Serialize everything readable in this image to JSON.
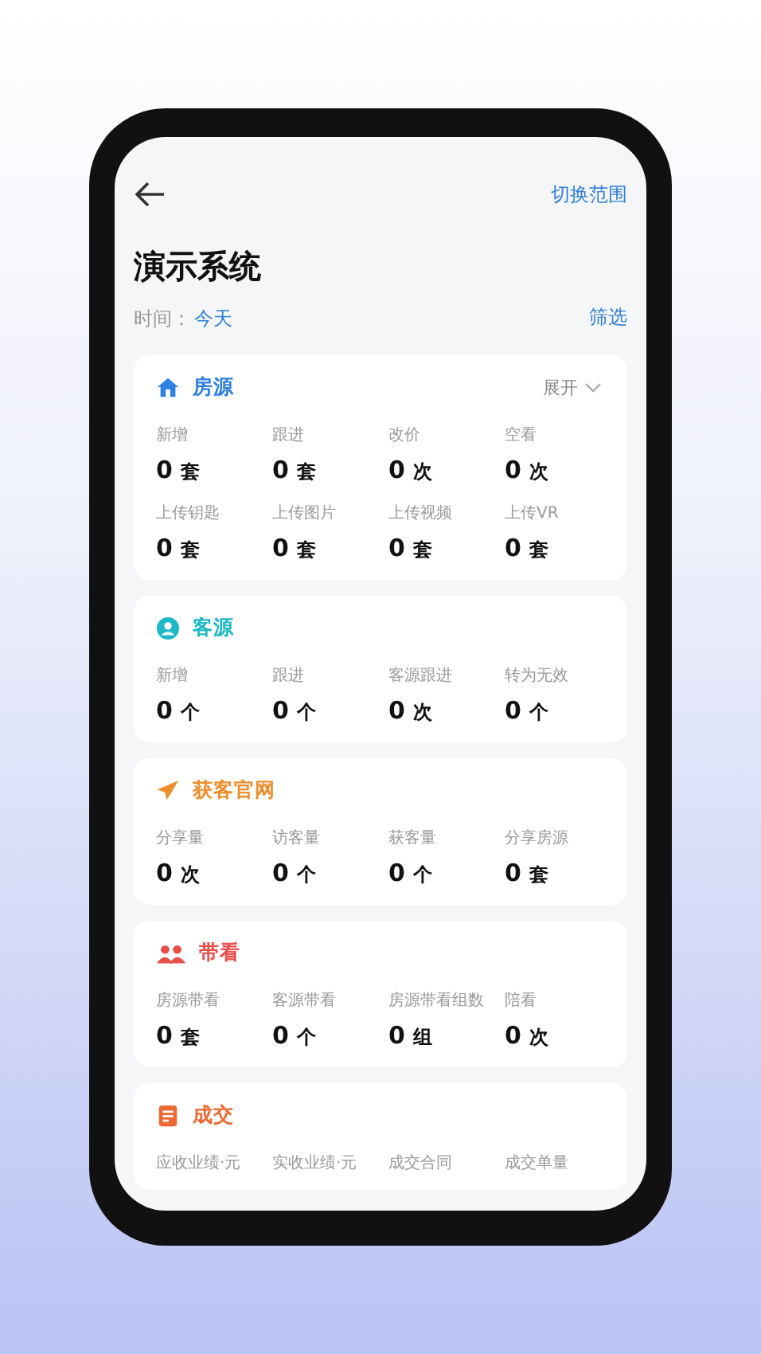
{
  "header": {
    "action": "切换范围",
    "title": "演示系统",
    "time_label": "时间：",
    "time_value": "今天",
    "filter": "筛选"
  },
  "sections": [
    {
      "kind": "house",
      "title": "房源",
      "color": "#2f80e0",
      "expand": "展开",
      "metrics": [
        {
          "label": "新增",
          "value": "0",
          "unit": "套"
        },
        {
          "label": "跟进",
          "value": "0",
          "unit": "套"
        },
        {
          "label": "改价",
          "value": "0",
          "unit": "次"
        },
        {
          "label": "空看",
          "value": "0",
          "unit": "次"
        },
        {
          "label": "上传钥匙",
          "value": "0",
          "unit": "套"
        },
        {
          "label": "上传图片",
          "value": "0",
          "unit": "套"
        },
        {
          "label": "上传视频",
          "value": "0",
          "unit": "套"
        },
        {
          "label": "上传VR",
          "value": "0",
          "unit": "套"
        }
      ]
    },
    {
      "kind": "person",
      "title": "客源",
      "color": "#1db8c6",
      "metrics": [
        {
          "label": "新增",
          "value": "0",
          "unit": "个"
        },
        {
          "label": "跟进",
          "value": "0",
          "unit": "个"
        },
        {
          "label": "客源跟进",
          "value": "0",
          "unit": "次"
        },
        {
          "label": "转为无效",
          "value": "0",
          "unit": "个"
        }
      ]
    },
    {
      "kind": "plane",
      "title": "获客官网",
      "color": "#ef8e2c",
      "metrics": [
        {
          "label": "分享量",
          "value": "0",
          "unit": "次"
        },
        {
          "label": "访客量",
          "value": "0",
          "unit": "个"
        },
        {
          "label": "获客量",
          "value": "0",
          "unit": "个"
        },
        {
          "label": "分享房源",
          "value": "0",
          "unit": "套"
        }
      ]
    },
    {
      "kind": "group",
      "title": "带看",
      "color": "#e84e4a",
      "metrics": [
        {
          "label": "房源带看",
          "value": "0",
          "unit": "套"
        },
        {
          "label": "客源带看",
          "value": "0",
          "unit": "个"
        },
        {
          "label": "房源带看组数",
          "value": "0",
          "unit": "组"
        },
        {
          "label": "陪看",
          "value": "0",
          "unit": "次"
        }
      ]
    },
    {
      "kind": "doc",
      "title": "成交",
      "color": "#ec6a32",
      "metrics": [
        {
          "label": "应收业绩·元"
        },
        {
          "label": "实收业绩·元"
        },
        {
          "label": "成交合同"
        },
        {
          "label": "成交单量"
        }
      ]
    }
  ]
}
